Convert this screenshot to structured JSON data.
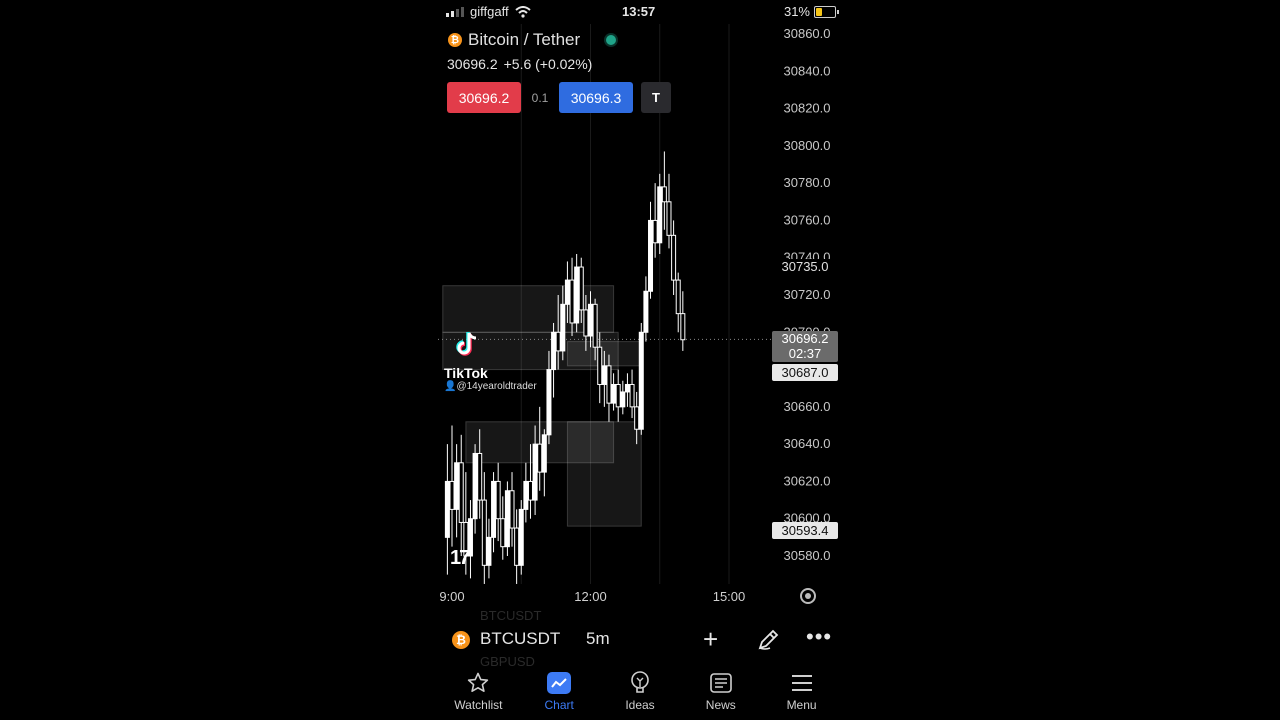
{
  "status_bar": {
    "carrier": "giffgaff",
    "time": "13:57",
    "battery": "31%",
    "battery_level": 0.31
  },
  "header": {
    "pair_title": "Bitcoin / Tether",
    "price": "30696.2",
    "change": "+5.6 (+0.02%)",
    "sell_price": "30696.2",
    "spread": "0.1",
    "buy_price": "30696.3",
    "tv_label": "T"
  },
  "chart_data": {
    "type": "candlestick",
    "y_ticks": [
      "30860.0",
      "30840.0",
      "30820.0",
      "30800.0",
      "30780.0",
      "30760.0",
      "30740.0",
      "30720.0",
      "30700.0",
      "30680.0",
      "30660.0",
      "30640.0",
      "30620.0",
      "30600.0",
      "30580.0"
    ],
    "ylim": [
      30560,
      30870
    ],
    "x_ticks": [
      "9:00",
      "12:00",
      "15:00"
    ],
    "x_tick_hours": [
      9,
      12,
      15
    ],
    "price_labels": {
      "current": "30696.2",
      "countdown": "02:37",
      "level_a": "30687.0",
      "level_b": "30593.4",
      "level_c": "30735.0"
    },
    "candles": [
      {
        "t": 8.9,
        "o": 30590,
        "h": 30640,
        "c": 30620,
        "l": 30570
      },
      {
        "t": 9.0,
        "o": 30620,
        "h": 30650,
        "c": 30605,
        "l": 30585
      },
      {
        "t": 9.1,
        "o": 30605,
        "h": 30640,
        "c": 30630,
        "l": 30590
      },
      {
        "t": 9.2,
        "o": 30630,
        "h": 30645,
        "c": 30598,
        "l": 30580
      },
      {
        "t": 9.3,
        "o": 30598,
        "h": 30625,
        "c": 30580,
        "l": 30570
      },
      {
        "t": 9.4,
        "o": 30580,
        "h": 30610,
        "c": 30600,
        "l": 30568
      },
      {
        "t": 9.5,
        "o": 30600,
        "h": 30640,
        "c": 30635,
        "l": 30592
      },
      {
        "t": 9.6,
        "o": 30635,
        "h": 30648,
        "c": 30610,
        "l": 30600
      },
      {
        "t": 9.7,
        "o": 30610,
        "h": 30625,
        "c": 30575,
        "l": 30565
      },
      {
        "t": 9.8,
        "o": 30575,
        "h": 30600,
        "c": 30590,
        "l": 30568
      },
      {
        "t": 9.9,
        "o": 30590,
        "h": 30625,
        "c": 30620,
        "l": 30582
      },
      {
        "t": 10.0,
        "o": 30620,
        "h": 30630,
        "c": 30600,
        "l": 30588
      },
      {
        "t": 10.1,
        "o": 30600,
        "h": 30612,
        "c": 30585,
        "l": 30578
      },
      {
        "t": 10.2,
        "o": 30585,
        "h": 30620,
        "c": 30615,
        "l": 30580
      },
      {
        "t": 10.3,
        "o": 30615,
        "h": 30625,
        "c": 30595,
        "l": 30585
      },
      {
        "t": 10.4,
        "o": 30595,
        "h": 30605,
        "c": 30575,
        "l": 30565
      },
      {
        "t": 10.5,
        "o": 30575,
        "h": 30610,
        "c": 30605,
        "l": 30570
      },
      {
        "t": 10.6,
        "o": 30605,
        "h": 30630,
        "c": 30620,
        "l": 30598
      },
      {
        "t": 10.7,
        "o": 30620,
        "h": 30640,
        "c": 30610,
        "l": 30600
      },
      {
        "t": 10.8,
        "o": 30610,
        "h": 30650,
        "c": 30640,
        "l": 30602
      },
      {
        "t": 10.9,
        "o": 30640,
        "h": 30660,
        "c": 30625,
        "l": 30615
      },
      {
        "t": 11.0,
        "o": 30625,
        "h": 30648,
        "c": 30645,
        "l": 30612
      },
      {
        "t": 11.1,
        "o": 30645,
        "h": 30690,
        "c": 30680,
        "l": 30640
      },
      {
        "t": 11.2,
        "o": 30680,
        "h": 30705,
        "c": 30700,
        "l": 30665
      },
      {
        "t": 11.3,
        "o": 30700,
        "h": 30720,
        "c": 30690,
        "l": 30680
      },
      {
        "t": 11.4,
        "o": 30690,
        "h": 30725,
        "c": 30715,
        "l": 30685
      },
      {
        "t": 11.5,
        "o": 30715,
        "h": 30738,
        "c": 30728,
        "l": 30705
      },
      {
        "t": 11.6,
        "o": 30728,
        "h": 30740,
        "c": 30705,
        "l": 30698
      },
      {
        "t": 11.7,
        "o": 30705,
        "h": 30742,
        "c": 30735,
        "l": 30700
      },
      {
        "t": 11.8,
        "o": 30735,
        "h": 30740,
        "c": 30712,
        "l": 30705
      },
      {
        "t": 11.9,
        "o": 30712,
        "h": 30720,
        "c": 30698,
        "l": 30690
      },
      {
        "t": 12.0,
        "o": 30698,
        "h": 30722,
        "c": 30715,
        "l": 30692
      },
      {
        "t": 12.1,
        "o": 30715,
        "h": 30718,
        "c": 30692,
        "l": 30685
      },
      {
        "t": 12.2,
        "o": 30692,
        "h": 30700,
        "c": 30672,
        "l": 30662
      },
      {
        "t": 12.3,
        "o": 30672,
        "h": 30690,
        "c": 30682,
        "l": 30660
      },
      {
        "t": 12.4,
        "o": 30682,
        "h": 30688,
        "c": 30662,
        "l": 30652
      },
      {
        "t": 12.5,
        "o": 30662,
        "h": 30678,
        "c": 30672,
        "l": 30658
      },
      {
        "t": 12.6,
        "o": 30672,
        "h": 30680,
        "c": 30660,
        "l": 30652
      },
      {
        "t": 12.7,
        "o": 30660,
        "h": 30674,
        "c": 30668,
        "l": 30656
      },
      {
        "t": 12.8,
        "o": 30668,
        "h": 30678,
        "c": 30672,
        "l": 30660
      },
      {
        "t": 12.9,
        "o": 30672,
        "h": 30680,
        "c": 30660,
        "l": 30654
      },
      {
        "t": 13.0,
        "o": 30660,
        "h": 30668,
        "c": 30648,
        "l": 30640
      },
      {
        "t": 13.1,
        "o": 30648,
        "h": 30705,
        "c": 30700,
        "l": 30645
      },
      {
        "t": 13.2,
        "o": 30700,
        "h": 30730,
        "c": 30722,
        "l": 30695
      },
      {
        "t": 13.3,
        "o": 30722,
        "h": 30770,
        "c": 30760,
        "l": 30718
      },
      {
        "t": 13.4,
        "o": 30760,
        "h": 30780,
        "c": 30748,
        "l": 30740
      },
      {
        "t": 13.5,
        "o": 30748,
        "h": 30785,
        "c": 30778,
        "l": 30742
      },
      {
        "t": 13.6,
        "o": 30778,
        "h": 30797,
        "c": 30770,
        "l": 30755
      },
      {
        "t": 13.7,
        "o": 30770,
        "h": 30785,
        "c": 30752,
        "l": 30745
      },
      {
        "t": 13.8,
        "o": 30752,
        "h": 30760,
        "c": 30728,
        "l": 30720
      },
      {
        "t": 13.9,
        "o": 30728,
        "h": 30732,
        "c": 30710,
        "l": 30700
      },
      {
        "t": 14.0,
        "o": 30710,
        "h": 30722,
        "c": 30696,
        "l": 30690
      }
    ],
    "zones": [
      {
        "t0": 8.8,
        "t1": 12.5,
        "p0": 30700,
        "p1": 30725
      },
      {
        "t0": 8.8,
        "t1": 12.6,
        "p0": 30680,
        "p1": 30700
      },
      {
        "t0": 9.3,
        "t1": 12.5,
        "p0": 30630,
        "p1": 30652
      },
      {
        "t0": 11.5,
        "t1": 13.1,
        "p0": 30596,
        "p1": 30652
      },
      {
        "t0": 11.5,
        "t1": 13.1,
        "p0": 30682,
        "p1": 30695
      }
    ],
    "colors": {
      "candle": "#ffffff",
      "zone": "#ffffff",
      "grid": "#1a1a1a"
    }
  },
  "watermark": {
    "brand": "TikTok",
    "handle": "@14yearoldtrader"
  },
  "tv_logo": "17",
  "symbol_bar": {
    "ghost_top": "BTCUSDT",
    "ghost_bottom": "GBPUSD",
    "coin_glyph": "₿",
    "symbol": "BTCUSDT",
    "timeframe": "5m"
  },
  "nav": [
    {
      "label": "Watchlist",
      "icon": "star-icon",
      "active": false
    },
    {
      "label": "Chart",
      "icon": "chart-icon",
      "active": true
    },
    {
      "label": "Ideas",
      "icon": "lightbulb-icon",
      "active": false
    },
    {
      "label": "News",
      "icon": "news-icon",
      "active": false
    },
    {
      "label": "Menu",
      "icon": "menu-icon",
      "active": false
    }
  ],
  "accent_color": "#3d7bf5"
}
